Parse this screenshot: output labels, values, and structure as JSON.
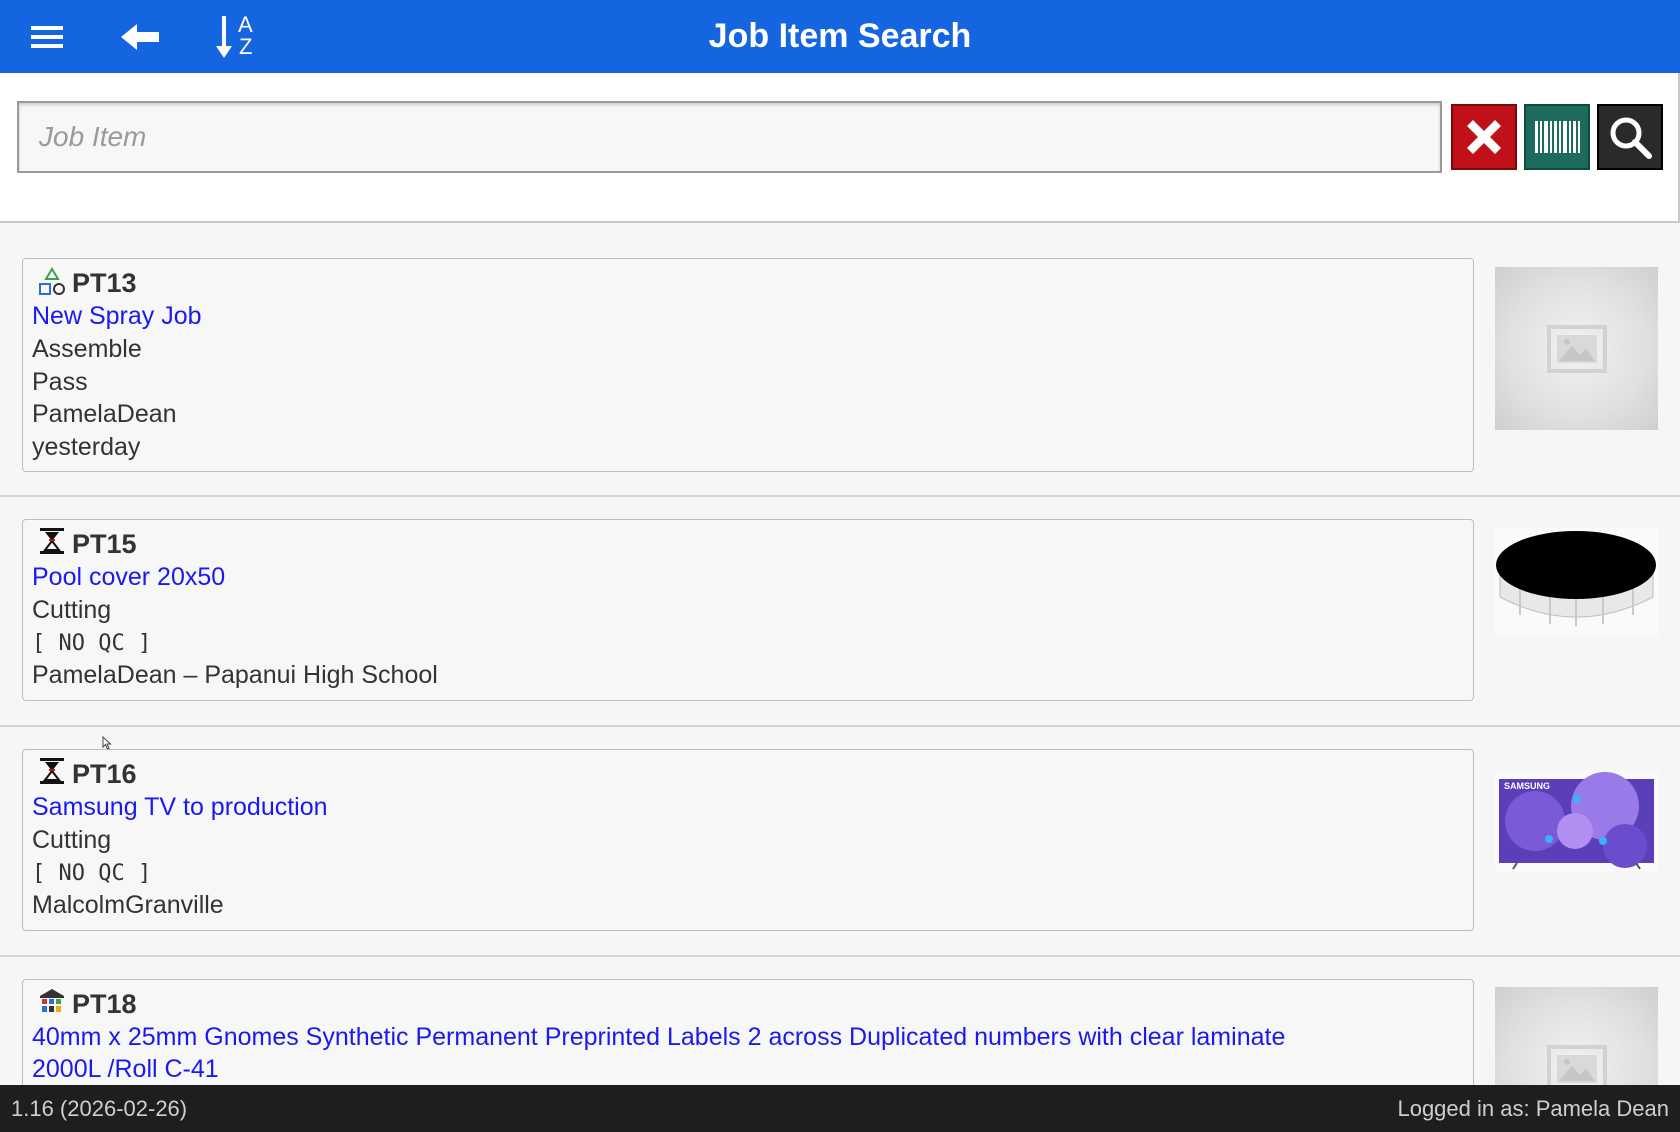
{
  "header": {
    "title": "Job Item Search",
    "sort_icon_labels": {
      "top": "A",
      "bottom": "Z"
    },
    "bg_color": "#1565e0"
  },
  "search": {
    "placeholder": "Job Item",
    "value": "",
    "clear_color": "#c01018",
    "barcode_color": "#1d6b5d",
    "search_color": "#2a2a2a"
  },
  "items": [
    {
      "code": "PT13",
      "icon": "shapes-icon",
      "lines": [
        "New Spray Job",
        "Assemble",
        "Pass",
        "PamelaDean",
        "yesterday"
      ],
      "thumb": "placeholder-image-icon"
    },
    {
      "code": "PT15",
      "icon": "cutting-icon",
      "lines": [
        "Pool cover 20x50",
        "Cutting",
        "[ NO QC ]",
        "PamelaDean – Papanui High School"
      ],
      "thumb": "pool-cover-image"
    },
    {
      "code": "PT16",
      "icon": "cutting-icon",
      "lines": [
        "Samsung TV to production",
        "Cutting",
        "[ NO QC ]",
        "MalcolmGranville"
      ],
      "thumb": "samsung-tv-image",
      "thumb_brand": "SAMSUNG"
    },
    {
      "code": "PT18",
      "icon": "factory-icon",
      "lines": [
        "40mm x 25mm Gnomes Synthetic Permanent Preprinted Labels 2 across Duplicated numbers with clear laminate",
        "2000L /Roll C-41"
      ],
      "thumb": "placeholder-image-icon"
    }
  ],
  "footer": {
    "version": "1.16 (2026-02-26)",
    "logged_in": "Logged in as: Pamela Dean"
  },
  "colors": {
    "link": "#1a1aee",
    "text": "#333333",
    "footer_bg": "#1e1e1e"
  }
}
